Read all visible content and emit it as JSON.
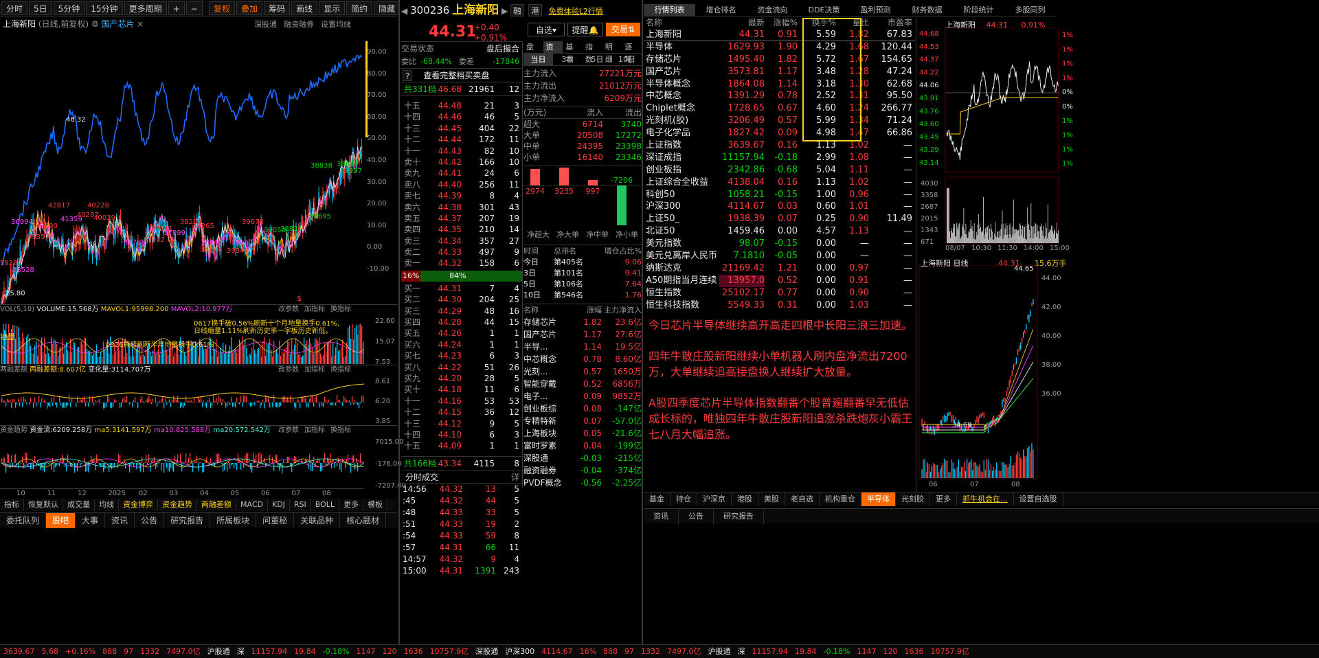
{
  "toolbar": {
    "left": [
      "分时",
      "5日",
      "5分钟",
      "15分钟",
      "更多周期"
    ],
    "right": [
      "复权",
      "叠加",
      "筹码",
      "画线",
      "显示",
      "简约",
      "隐藏"
    ]
  },
  "chart": {
    "title": "上海新阳",
    "subtitle": "(日线,前复权)",
    "concept": "国产芯片",
    "tabs": [
      "深股通",
      "融资融券",
      "设置均线"
    ],
    "yticks": [
      "90.00",
      "80.00",
      "70.00",
      "60.00",
      "50.00",
      "40.00",
      "30.00",
      "20.00",
      "10.00",
      "0.00",
      "-10.00"
    ],
    "price_labels": [
      "46.32",
      "42817",
      "40228",
      "41359",
      "40287",
      "40039",
      "36994",
      "39357",
      "42790",
      "38528",
      "39287",
      "25.80",
      "38786",
      "37932",
      "37911",
      "37899",
      "38201",
      "38265",
      "38840",
      "38282",
      "39344",
      "39030",
      "39678",
      "39050",
      "38831",
      "38838",
      "38695",
      "38837",
      "38037"
    ],
    "sec_labels": [
      "$"
    ]
  },
  "vol": {
    "title": "VOL(5,10)",
    "volume": "VOLUME:15.568万",
    "mavol1": "MAVOL1:95998.200",
    "mavol2": "MAVOL2:10.977万",
    "btns": [
      "改参数",
      "加指标",
      "换指标"
    ],
    "ticks": [
      "22.60",
      "15.07",
      "7.53"
    ],
    "notes": [
      "0617换手破0.56%刷新十个月地量换手0.61%,",
      "日线缩量1.11%刷新历史率一字板历史新低。",
      "0326持续刷新半年地量换手0.61%"
    ],
    "left_note": "地量"
  },
  "margin": {
    "title": "两融差额",
    "val": "两融差额:8.607亿",
    "chg": "变化量:3114.707万",
    "btns": [
      "改参数",
      "加指标",
      "换指标"
    ],
    "ticks": [
      "8.61",
      "6.20",
      "3.85"
    ]
  },
  "fund": {
    "title": "资金趋势",
    "val": "资金流:6209.258万",
    "ma5": "ma5:3141.597万",
    "ma10": "ma10:825.588万",
    "ma20": "ma20:572.542万",
    "btns": [
      "改参数",
      "加指标",
      "换指标"
    ],
    "ticks": [
      "7015.00",
      "-176.00",
      "-7207.00"
    ]
  },
  "xaxis": [
    "10",
    "11",
    "12",
    "2025",
    "02",
    "03",
    "04",
    "05",
    "06",
    "07",
    "08"
  ],
  "bottom_tabs_left": [
    "指标",
    "恢复默认",
    "成交量",
    "均线",
    "资金博弈",
    "资金趋势",
    "两融差额",
    "MACD",
    "KDJ",
    "RSI",
    "BOLL",
    "更多",
    "模板"
  ],
  "bottom_tabs2": [
    "委托队列",
    "股吧",
    "大事",
    "资讯",
    "公告",
    "研究报告",
    "所属板块",
    "问董秘",
    "关联品种",
    "核心题材"
  ],
  "quote": {
    "code": "300236",
    "name": "上海新阳",
    "price": "44.31",
    "chg": "+0.40",
    "pct": "+0.91%",
    "tags": [
      "融",
      "港"
    ],
    "l2": "免费体验L2行情",
    "self": "自选",
    "remind": "提醒",
    "trade": "交易",
    "status": "交易状态",
    "status_v": "盘后撮合",
    "wb_lbl": "委比",
    "wb": "-68.44%",
    "wc_lbl": "委差",
    "wc": "-17846",
    "full": "查看完整档买卖盘",
    "sell_total": [
      "共331档",
      "46.68",
      "21961",
      "12"
    ],
    "sells": [
      [
        "十五",
        "44.48",
        "21",
        "3"
      ],
      [
        "十四",
        "44.46",
        "46",
        "5"
      ],
      [
        "十三",
        "44.45",
        "404",
        "22"
      ],
      [
        "十二",
        "44.44",
        "172",
        "11"
      ],
      [
        "十一",
        "44.43",
        "82",
        "10"
      ],
      [
        "卖十",
        "44.42",
        "166",
        "10"
      ],
      [
        "卖九",
        "44.41",
        "24",
        "6"
      ],
      [
        "卖八",
        "44.40",
        "256",
        "11"
      ],
      [
        "卖七",
        "44.39",
        "8",
        "4"
      ],
      [
        "卖六",
        "44.38",
        "301",
        "43"
      ],
      [
        "卖五",
        "44.37",
        "207",
        "19"
      ],
      [
        "卖四",
        "44.35",
        "210",
        "14"
      ],
      [
        "卖三",
        "44.34",
        "357",
        "27"
      ],
      [
        "卖二",
        "44.33",
        "497",
        "9"
      ],
      [
        "卖一",
        "44.32",
        "158",
        "6"
      ]
    ],
    "ratio_l": "16%",
    "ratio_r": "84%",
    "buys": [
      [
        "买一",
        "44.31",
        "7",
        "4"
      ],
      [
        "买二",
        "44.30",
        "204",
        "25"
      ],
      [
        "买三",
        "44.29",
        "48",
        "16"
      ],
      [
        "买四",
        "44.28",
        "44",
        "15"
      ],
      [
        "买五",
        "44.26",
        "1",
        "1"
      ],
      [
        "买六",
        "44.24",
        "1",
        "1"
      ],
      [
        "买七",
        "44.23",
        "6",
        "3"
      ],
      [
        "买八",
        "44.22",
        "51",
        "26"
      ],
      [
        "买九",
        "44.20",
        "28",
        "5"
      ],
      [
        "买十",
        "44.18",
        "11",
        "6"
      ],
      [
        "十一",
        "44.16",
        "53",
        "53"
      ],
      [
        "十二",
        "44.15",
        "36",
        "12"
      ],
      [
        "十三",
        "44.12",
        "9",
        "5"
      ],
      [
        "十四",
        "44.10",
        "6",
        "3"
      ],
      [
        "十五",
        "44.09",
        "1",
        "1"
      ]
    ],
    "buy_total": [
      "共166档",
      "43.34",
      "4115",
      "8"
    ],
    "ticks_title": "分时成交",
    "ticks_btn": "详",
    "trades": [
      [
        "14:56",
        "44.32",
        "13",
        "5"
      ],
      [
        ":45",
        "44.32",
        "44",
        "5"
      ],
      [
        ":48",
        "44.33",
        "33",
        "5"
      ],
      [
        ":51",
        "44.33",
        "19",
        "2"
      ],
      [
        ":54",
        "44.33",
        "59",
        "8"
      ],
      [
        ":57",
        "44.31",
        "66",
        "11"
      ],
      [
        "14:57",
        "44.32",
        "9",
        "4"
      ],
      [
        "15:00",
        "44.31",
        "1391",
        "243"
      ]
    ]
  },
  "flow": {
    "tabs": [
      "盘口",
      "资金",
      "基本",
      "指数",
      "明细",
      "逐笔"
    ],
    "days": [
      "当日",
      "3日",
      "5日",
      "10日"
    ],
    "main": [
      [
        "主力流入",
        "27221万元"
      ],
      [
        "主力流出",
        "21012万元"
      ],
      [
        "主力净流入",
        "6209万元"
      ]
    ],
    "head": [
      "(万元)",
      "流入",
      "流出"
    ],
    "rows": [
      [
        "超大",
        "6714",
        "3740"
      ],
      [
        "大单",
        "20508",
        "17272"
      ],
      [
        "中单",
        "24395",
        "23398"
      ],
      [
        "小单",
        "16140",
        "23346"
      ]
    ],
    "bars": [
      [
        "2974",
        "净超大"
      ],
      [
        "3235",
        "净大单"
      ],
      [
        "997",
        "净中单"
      ],
      [
        "-7206",
        "净小单"
      ]
    ],
    "rank_head": [
      "时间",
      "总排名",
      "增仓占比%"
    ],
    "ranks": [
      [
        "今日",
        "第405名",
        "9.06"
      ],
      [
        "3日",
        "第101名",
        "9.41"
      ],
      [
        "5日",
        "第106名",
        "7.64"
      ],
      [
        "10日",
        "第546名",
        "1.76"
      ]
    ],
    "sect_head": [
      "名称",
      "涨幅",
      "主力净流入"
    ],
    "sects": [
      [
        "存储芯片",
        "1.82",
        "23.6亿"
      ],
      [
        "国产芯片",
        "1.17",
        "27.6亿"
      ],
      [
        "半导...",
        "1.14",
        "19.5亿"
      ],
      [
        "中芯概念",
        "0.78",
        "8.60亿"
      ],
      [
        "光刻...",
        "0.57",
        "1650万"
      ],
      [
        "智能穿戴",
        "0.52",
        "6856万"
      ],
      [
        "电子...",
        "0.09",
        "9852万"
      ],
      [
        "创业板综",
        "0.08",
        "-147亿"
      ],
      [
        "专精特新",
        "0.07",
        "-57.0亿"
      ],
      [
        "上海板块",
        "0.05",
        "-21.6亿"
      ],
      [
        "富时罗素",
        "0.04",
        "-199亿"
      ],
      [
        "深股通",
        "-0.03",
        "-215亿"
      ],
      [
        "融资融券",
        "-0.04",
        "-374亿"
      ],
      [
        "PVDF概念",
        "-0.56",
        "-2.25亿"
      ]
    ]
  },
  "list": {
    "tabs": [
      "行情列表",
      "增仓排名",
      "资金流向",
      "DDE决策",
      "盈利预测",
      "财务数据",
      "阶段统计",
      "多股同列"
    ],
    "head": [
      "名称",
      "最新",
      "涨幅%",
      "换手%",
      "量比",
      "市盈率"
    ],
    "rows": [
      [
        "上海新阳",
        "44.31",
        "0.91",
        "5.59",
        "1.82",
        "67.83"
      ],
      [
        "半导体",
        "1629.93",
        "1.90",
        "4.29",
        "1.68",
        "120.44"
      ],
      [
        "存储芯片",
        "1495.40",
        "1.82",
        "5.72",
        "1.67",
        "154.65"
      ],
      [
        "国产芯片",
        "3573.81",
        "1.17",
        "3.48",
        "1.28",
        "47.24"
      ],
      [
        "半导体概念",
        "1864.08",
        "1.14",
        "3.18",
        "1.30",
        "62.68"
      ],
      [
        "中芯概念",
        "1391.29",
        "0.78",
        "2.52",
        "1.31",
        "95.50"
      ],
      [
        "Chiplet概念",
        "1728.65",
        "0.67",
        "4.60",
        "1.24",
        "266.77"
      ],
      [
        "光刻机(胶)",
        "3206.49",
        "0.57",
        "5.99",
        "1.34",
        "71.24"
      ],
      [
        "电子化学品",
        "1827.42",
        "0.09",
        "4.98",
        "1.47",
        "66.86"
      ],
      [
        "上证指数",
        "3639.67",
        "0.16",
        "1.13",
        "1.02",
        "—"
      ],
      [
        "深证成指",
        "11157.94",
        "-0.18",
        "2.99",
        "1.08",
        "—"
      ],
      [
        "创业板指",
        "2342.86",
        "-0.68",
        "5.04",
        "1.11",
        "—"
      ],
      [
        "上证综合全收益",
        "4138.04",
        "0.16",
        "1.13",
        "1.02",
        "—"
      ],
      [
        "科创50",
        "1058.21",
        "-0.15",
        "1.00",
        "0.96",
        "—"
      ],
      [
        "沪深300",
        "4114.67",
        "0.03",
        "0.60",
        "1.01",
        "—"
      ],
      [
        "上证50_",
        "1938.39",
        "0.07",
        "0.25",
        "0.90",
        "11.49"
      ],
      [
        "北证50",
        "1459.46",
        "0.00",
        "4.57",
        "1.13",
        "—"
      ],
      [
        "美元指数",
        "98.07",
        "-0.15",
        "0.00",
        "—",
        "—"
      ],
      [
        "美元兑离岸人民币",
        "7.1810",
        "-0.05",
        "0.00",
        "—",
        "—"
      ],
      [
        "纳斯达克",
        "21169.42",
        "1.21",
        "0.00",
        "0.97",
        "—"
      ],
      [
        "A50期指当月连续",
        "13957.0",
        "0.52",
        "0.00",
        "0.91",
        "—"
      ],
      [
        "恒生指数",
        "25102.17",
        "0.77",
        "0.00",
        "0.90",
        "—"
      ],
      [
        "恒生科技指数",
        "5549.33",
        "0.31",
        "0.00",
        "1.03",
        "—"
      ]
    ],
    "note": [
      "今日芯片半导体继续高开高走四根中长阳三浪三加速。",
      "四年牛散庄股新阳继续小单机器人刷内盘净流出7200万，大单继续追高接盘换人继续扩大放量。",
      "A股四季度芯片半导体指数翻番个股普遍翻番早无低估成长标的，唯独四年牛散庄股新阳追涨杀跌炮灰小霸王七八月大幅追涨。"
    ],
    "btabs": [
      "基金",
      "持仓",
      "沪深京",
      "港股",
      "美股",
      "老自选",
      "机构重仓",
      "半导体",
      "光刻胶",
      "更多",
      "抓牛机会在...",
      "设置自选股"
    ],
    "btabs2": [
      "资讯",
      "公告",
      "研究报告"
    ]
  },
  "mini": {
    "name": "上海新阳",
    "price": "44.31",
    "pct": "0.91%",
    "ly": [
      "44.68",
      "44.53",
      "44.37",
      "44.22",
      "44.06",
      "43.91",
      "43.76",
      "43.60",
      "43.45",
      "43.29",
      "43.14"
    ],
    "ry": [
      "1%",
      "1%",
      "1%",
      "1%",
      "0%",
      "0%",
      "1%",
      "1%",
      "1%",
      "1%"
    ],
    "vy": [
      "4030",
      "3358",
      "2687",
      "2015",
      "1343",
      "671"
    ],
    "vx": [
      "08/07",
      "10:30",
      "11:30",
      "14:00",
      "15:00"
    ],
    "day_name": "上海新阳",
    "day_lbl": "日线",
    "day_price": "44.31",
    "day_vol": "15.6万手",
    "day_hi": "44.65",
    "day_lo": "34.69",
    "day_y": [
      "44.00",
      "42.00",
      "40.00",
      "38.00",
      "36.00"
    ],
    "day_x": [
      "06",
      "07",
      "08"
    ]
  },
  "status": {
    "items": [
      "3639.67",
      "5.68",
      "+0.16%",
      "888",
      "97",
      "1332",
      "7497.0亿",
      "沪股通",
      "深",
      "11157.94",
      "19.84",
      "-0.18%",
      "1147",
      "120",
      "1636",
      "10757.9亿",
      "深股通",
      "沪深300",
      "4114.67"
    ],
    "r": [
      "16%",
      "888",
      "97",
      "1332",
      "7497.0亿",
      "沪股通",
      "深",
      "11157.94",
      "19.84",
      "-0.18%",
      "1147",
      "120",
      "1636",
      "10757.9亿"
    ]
  }
}
